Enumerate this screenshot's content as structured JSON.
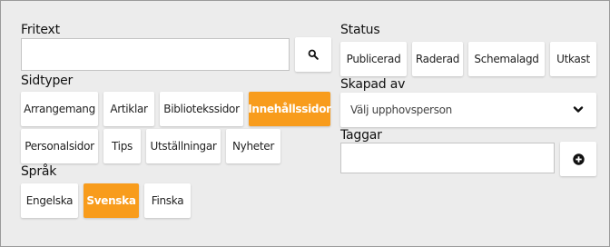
{
  "fritext": {
    "label": "Fritext",
    "value": "",
    "placeholder": "",
    "search_icon": "search-icon"
  },
  "sidtyper": {
    "label": "Sidtyper",
    "items": [
      {
        "label": "Arrangemang",
        "active": false
      },
      {
        "label": "Artiklar",
        "active": false
      },
      {
        "label": "Bibliotekssidor",
        "active": false
      },
      {
        "label": "Innehållssidor",
        "active": true
      },
      {
        "label": "Personalsidor",
        "active": false
      },
      {
        "label": "Tips",
        "active": false
      },
      {
        "label": "Utställningar",
        "active": false
      },
      {
        "label": "Nyheter",
        "active": false
      }
    ]
  },
  "sprak": {
    "label": "Språk",
    "items": [
      {
        "label": "Engelska",
        "active": false
      },
      {
        "label": "Svenska",
        "active": true
      },
      {
        "label": "Finska",
        "active": false
      }
    ]
  },
  "status": {
    "label": "Status",
    "items": [
      {
        "label": "Publicerad"
      },
      {
        "label": "Raderad"
      },
      {
        "label": "Schemalagd"
      },
      {
        "label": "Utkast"
      }
    ]
  },
  "skapad_av": {
    "label": "Skapad av",
    "selected": "Välj upphovsperson",
    "icon": "chevron-down-icon"
  },
  "taggar": {
    "label": "Taggar",
    "value": "",
    "add_icon": "plus-circle-icon"
  },
  "colors": {
    "accent": "#f89c1c",
    "panel": "#ececec"
  }
}
